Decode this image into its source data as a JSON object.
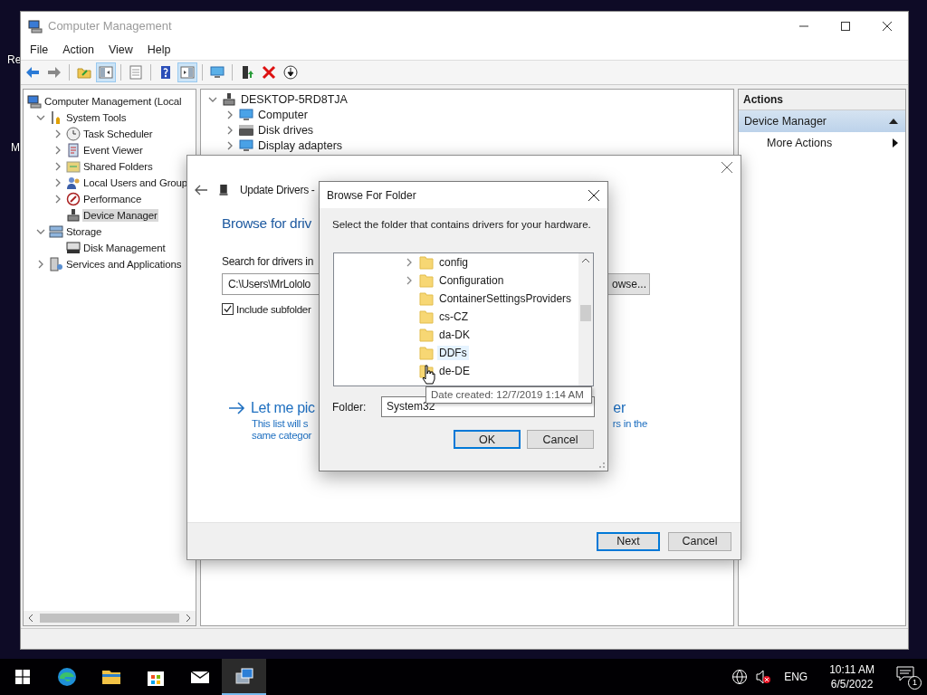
{
  "desktop": {
    "icon_labels": [
      {
        "label": "Re"
      },
      {
        "label": "M"
      }
    ]
  },
  "window": {
    "title": "Computer Management",
    "menu": [
      "File",
      "Action",
      "View",
      "Help"
    ],
    "toolbar": [
      [
        {
          "kind": "back",
          "pressed": false
        },
        {
          "kind": "forward",
          "pressed": false
        }
      ],
      [
        {
          "kind": "up",
          "pressed": false
        },
        {
          "kind": "tree",
          "pressed": true
        }
      ],
      [
        {
          "kind": "export",
          "pressed": false
        }
      ],
      [
        {
          "kind": "help",
          "pressed": false
        },
        {
          "kind": "actionpane",
          "pressed": true
        }
      ],
      [
        {
          "kind": "monitor",
          "pressed": false
        }
      ],
      [
        {
          "kind": "update",
          "pressed": false
        },
        {
          "kind": "delete",
          "pressed": false
        },
        {
          "kind": "download",
          "pressed": false
        }
      ]
    ]
  },
  "nav_tree": [
    {
      "label": "Computer Management (Local",
      "kind": "computer",
      "selected": false,
      "children": [
        {
          "label": "System Tools",
          "kind": "tools",
          "expanded": true,
          "selected": false,
          "children": [
            {
              "label": "Task Scheduler",
              "kind": "clock",
              "expanded": false,
              "selected": false
            },
            {
              "label": "Event Viewer",
              "kind": "log",
              "expanded": false,
              "selected": false
            },
            {
              "label": "Shared Folders",
              "kind": "share",
              "expanded": false,
              "selected": false
            },
            {
              "label": "Local Users and Group",
              "kind": "users",
              "expanded": false,
              "selected": false
            },
            {
              "label": "Performance",
              "kind": "perf",
              "expanded": false,
              "selected": false
            },
            {
              "label": "Device Manager",
              "kind": "device",
              "selected": true
            }
          ]
        },
        {
          "label": "Storage",
          "kind": "storage",
          "expanded": true,
          "selected": false,
          "children": [
            {
              "label": "Disk Management",
              "kind": "disk",
              "selected": false
            }
          ]
        },
        {
          "label": "Services and Applications",
          "kind": "services",
          "expanded": false,
          "selected": false
        }
      ]
    }
  ],
  "device_tree": [
    {
      "label": "DESKTOP-5RD8TJA",
      "kind": "pc",
      "expanded": true,
      "children": [
        {
          "label": "Computer",
          "kind": "monitor",
          "expanded": false
        },
        {
          "label": "Disk drives",
          "kind": "drive",
          "expanded": false
        },
        {
          "label": "Display adapters",
          "kind": "monitor",
          "expanded": false
        }
      ]
    }
  ],
  "actions": {
    "title": "Actions",
    "items": [
      {
        "label": "Device Manager",
        "kind": "header"
      },
      {
        "label": "More Actions",
        "kind": "submenu"
      }
    ]
  },
  "update_dialog": {
    "title": "Update Drivers -",
    "heading": "Browse for driv",
    "search_label": "Search for drivers in",
    "path": "C:\\Users\\MrLololo",
    "browse_button": "owse...",
    "include_subfolders": {
      "label": "Include subfolder",
      "checked": true
    },
    "pick": {
      "title": "Let me pic",
      "title_end": "er",
      "description": "This list will s",
      "description_end": "rs in the",
      "description_line2": "same categor"
    },
    "buttons": [
      {
        "label": "Next",
        "default": true
      },
      {
        "label": "Cancel",
        "default": false
      }
    ]
  },
  "browse_dialog": {
    "title": "Browse For Folder",
    "instruction": "Select the folder that contains drivers for your hardware.",
    "folders": [
      {
        "label": "config",
        "expanded": false,
        "hovered": false,
        "selected": false
      },
      {
        "label": "Configuration",
        "expanded": false,
        "hovered": false,
        "selected": false
      },
      {
        "label": "ContainerSettingsProviders",
        "hovered": false,
        "selected": false
      },
      {
        "label": "cs-CZ",
        "hovered": false,
        "selected": false
      },
      {
        "label": "da-DK",
        "hovered": false,
        "selected": false
      },
      {
        "label": "DDFs",
        "hovered": true,
        "selected": false
      },
      {
        "label": "de-DE",
        "hovered": false,
        "selected": false
      }
    ],
    "tooltip": "Date created: 12/7/2019 1:14 AM",
    "folder_label": "Folder:",
    "folder_value": "System32",
    "buttons": [
      {
        "label": "OK",
        "default": true
      },
      {
        "label": "Cancel",
        "default": false
      }
    ]
  },
  "taskbar": {
    "apps": [
      {
        "kind": "edge",
        "active": false
      },
      {
        "kind": "explorer",
        "active": false
      },
      {
        "kind": "store",
        "active": false
      },
      {
        "kind": "mail",
        "active": false
      },
      {
        "kind": "compmgmt",
        "active": true
      }
    ],
    "muted": true,
    "language": "ENG",
    "time": "10:11 AM",
    "date": "6/5/2022",
    "notifications": "1"
  }
}
